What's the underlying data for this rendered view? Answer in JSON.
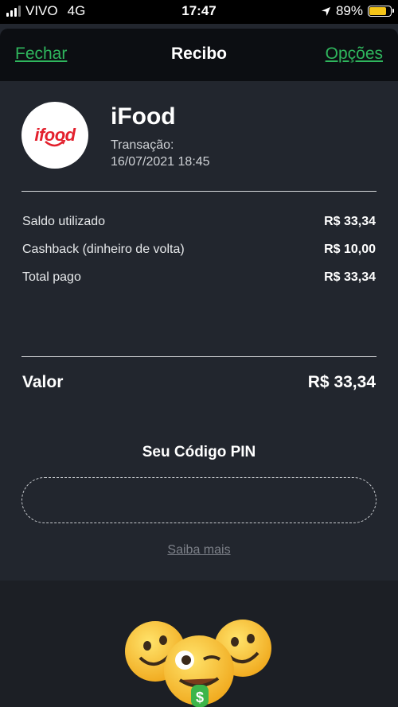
{
  "status_bar": {
    "carrier": "VIVO",
    "network": "4G",
    "time": "17:47",
    "battery_percent": "89%",
    "battery_level": 0.89
  },
  "nav": {
    "left": "Fechar",
    "title": "Recibo",
    "right": "Opções"
  },
  "merchant": {
    "logo_text": "ifood",
    "name": "iFood",
    "transaction_label": "Transação:",
    "transaction_date": "16/07/2021 18:45"
  },
  "summary": [
    {
      "label": "Saldo utilizado",
      "amount": "R$ 33,34"
    },
    {
      "label": "Cashback (dinheiro de volta)",
      "amount": "R$ 10,00"
    },
    {
      "label": "Total pago",
      "amount": "R$ 33,34"
    }
  ],
  "total": {
    "label": "Valor",
    "amount": "R$ 33,34"
  },
  "pin": {
    "title": "Seu Código PIN",
    "link": "Saiba mais"
  },
  "colors": {
    "accent": "#2fb65d",
    "background": "#22262e",
    "brand": "#e3202d"
  },
  "icons": [
    "signal-icon",
    "location-arrow-icon",
    "battery-icon",
    "emoji-group-icon"
  ]
}
